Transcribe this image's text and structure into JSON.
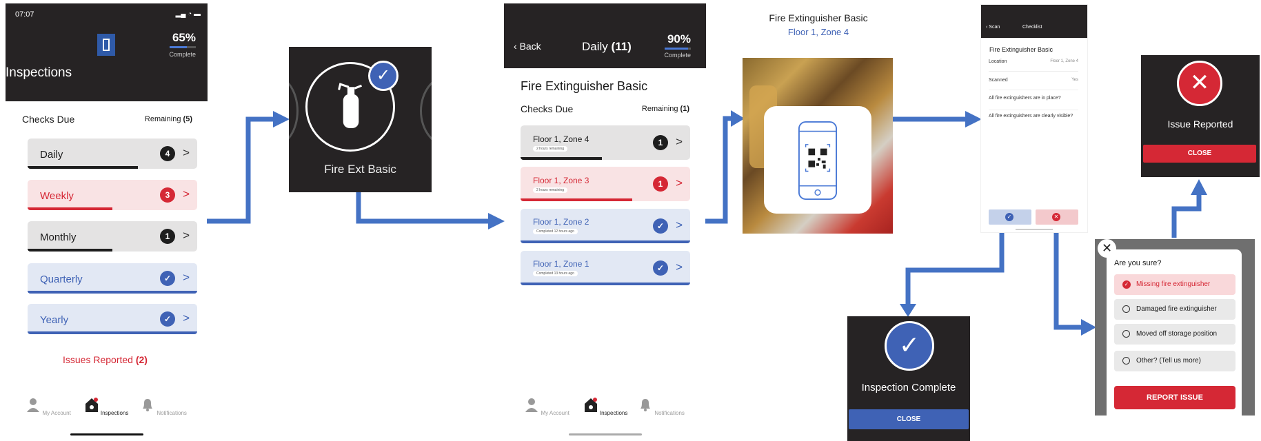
{
  "screen1": {
    "time": "07:07",
    "percent": "65%",
    "complete_label": "Complete",
    "title": "Inspections",
    "checks_due": "Checks Due",
    "remaining_label": "Remaining",
    "remaining_count": "(5)",
    "items": [
      {
        "label": "Daily",
        "badge": "4",
        "progress": 0.65
      },
      {
        "label": "Weekly",
        "badge": "3",
        "progress": 0.5
      },
      {
        "label": "Monthly",
        "badge": "1",
        "progress": 0.5
      },
      {
        "label": "Quarterly",
        "badge": "check",
        "progress": 1.0
      },
      {
        "label": "Yearly",
        "badge": "check",
        "progress": 1.0
      }
    ],
    "issues_label": "Issues Reported",
    "issues_count": "(2)",
    "tabs": [
      "My Account",
      "Inspections",
      "Notifications"
    ]
  },
  "screen2": {
    "title": "Fire Ext Basic"
  },
  "screen3": {
    "back": "Back",
    "header": "Daily",
    "header_count": "(11)",
    "percent": "90%",
    "complete_label": "Complete",
    "title": "Fire Extinguisher Basic",
    "checks_due": "Checks Due",
    "remaining_label": "Remaining",
    "remaining_count": "(1)",
    "items": [
      {
        "label": "Floor 1, Zone 4",
        "sub": "2 hours remaining",
        "badge": "1"
      },
      {
        "label": "Floor 1, Zone 3",
        "sub": "2 hours remaining",
        "badge": "1"
      },
      {
        "label": "Floor 1, Zone 2",
        "sub": "Completed 12 hours ago",
        "badge": "check"
      },
      {
        "label": "Floor 1, Zone 1",
        "sub": "Completed 13 hours ago",
        "badge": "check"
      }
    ],
    "tabs": [
      "My Account",
      "Inspections",
      "Notifications"
    ]
  },
  "screen4": {
    "title": "Fire Extinguisher Basic",
    "subtitle": "Floor 1, Zone 4"
  },
  "screen5": {
    "back": "Scan",
    "header": "Checklist",
    "title": "Fire Extinguisher Basic",
    "rows": [
      {
        "label": "Location",
        "value": "Floor 1, Zone 4"
      },
      {
        "label": "Scanned",
        "value": "Yes"
      }
    ],
    "questions": [
      "All fire extinguishers are in place?",
      "All fire extinguishers are clearly visible?"
    ]
  },
  "screen6": {
    "title": "Issue Reported",
    "button": "CLOSE"
  },
  "screen7": {
    "title": "Inspection Complete",
    "button": "CLOSE"
  },
  "screen8": {
    "question": "Are you sure?",
    "options": [
      "Missing fire extinguisher",
      "Damaged fire extinguisher",
      "Moved off storage position",
      "Other? (Tell us more)"
    ],
    "button": "REPORT ISSUE"
  },
  "colors": {
    "red": "#d52835",
    "blue": "#3f62b5",
    "dark": "#262324",
    "arrow": "#4472c4"
  }
}
